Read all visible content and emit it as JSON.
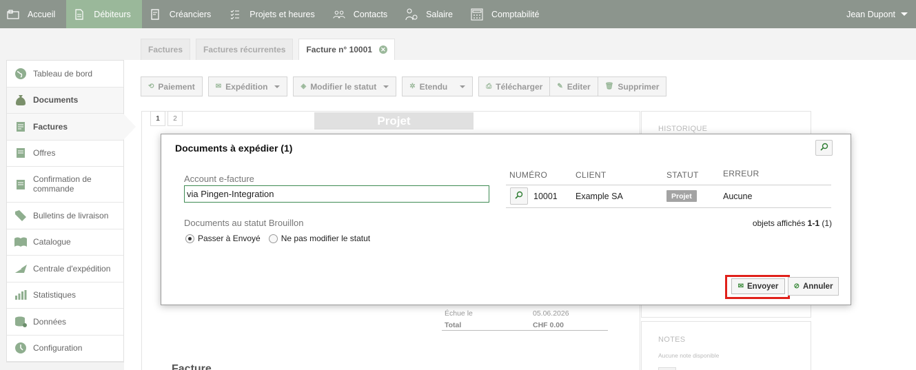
{
  "topnav": {
    "items": [
      {
        "label": "Accueil",
        "icon": "home-icon"
      },
      {
        "label": "Débiteurs",
        "icon": "document-icon"
      },
      {
        "label": "Créanciers",
        "icon": "receipt-icon"
      },
      {
        "label": "Projets et heures",
        "icon": "checklist-icon"
      },
      {
        "label": "Contacts",
        "icon": "people-icon"
      },
      {
        "label": "Salaire",
        "icon": "salary-icon"
      },
      {
        "label": "Comptabilité",
        "icon": "calculator-icon"
      }
    ],
    "active": "Débiteurs",
    "user": "Jean Dupont"
  },
  "tabs": [
    {
      "label": "Factures"
    },
    {
      "label": "Factures récurrentes"
    },
    {
      "label": "Facture n° 10001"
    }
  ],
  "sidebar": {
    "items": [
      {
        "label": "Tableau de bord",
        "icon": "globe-icon"
      },
      {
        "label": "Documents",
        "icon": "money-bag-icon"
      },
      {
        "label": "Factures",
        "icon": "invoice-icon"
      },
      {
        "label": "Offres",
        "icon": "offer-icon"
      },
      {
        "label": "Confirmation de commande",
        "icon": "order-icon"
      },
      {
        "label": "Bulletins de livraison",
        "icon": "tag-icon"
      },
      {
        "label": "Catalogue",
        "icon": "book-icon"
      },
      {
        "label": "Centrale d'expédition",
        "icon": "shipping-icon"
      },
      {
        "label": "Statistiques",
        "icon": "bar-chart-icon"
      },
      {
        "label": "Données",
        "icon": "database-icon"
      },
      {
        "label": "Configuration",
        "icon": "settings-icon"
      }
    ]
  },
  "toolbar": {
    "paiement": "Paiement",
    "expedition": "Expédition",
    "modifier_statut": "Modifier le statut",
    "etendu": "Etendu",
    "telecharger": "Télécharger",
    "editer": "Editer",
    "supprimer": "Supprimer"
  },
  "document": {
    "pages": [
      "1",
      "2"
    ],
    "banner": "Projet",
    "due_label": "Échue le",
    "due_value": "05.06.2026",
    "total_label": "Total",
    "total_value": "CHF 0.00",
    "heading": "Facture"
  },
  "side_panels": {
    "history_title": "HISTORIQUE",
    "notes_title": "NOTES",
    "notes_empty": "Aucune note disponible"
  },
  "dialog": {
    "title": "Documents à expédier (1)",
    "account_label": "Account e-facture",
    "account_value": "via Pingen-Integration",
    "draft_label": "Documents au statut Brouillon",
    "radio_envoye": "Passer à Envoyé",
    "radio_keep": "Ne pas modifier le statut",
    "radio_selected": "Passer à Envoyé",
    "columns": {
      "numero": "NUMÉRO",
      "client": "CLIENT",
      "statut": "STATUT",
      "erreur": "ERREUR"
    },
    "rows": [
      {
        "numero": "10001",
        "client": "Example SA",
        "statut": "Projet",
        "erreur": "Aucune"
      }
    ],
    "pager_prefix": "objets affichés ",
    "pager_range": "1-1",
    "pager_total": " (1)",
    "send_label": "Envoyer",
    "cancel_label": "Annuler"
  },
  "colors": {
    "nav_bg": "#8c958d",
    "nav_active": "#9ab89a",
    "input_border": "#3e8a52",
    "highlight": "#e0201a"
  }
}
